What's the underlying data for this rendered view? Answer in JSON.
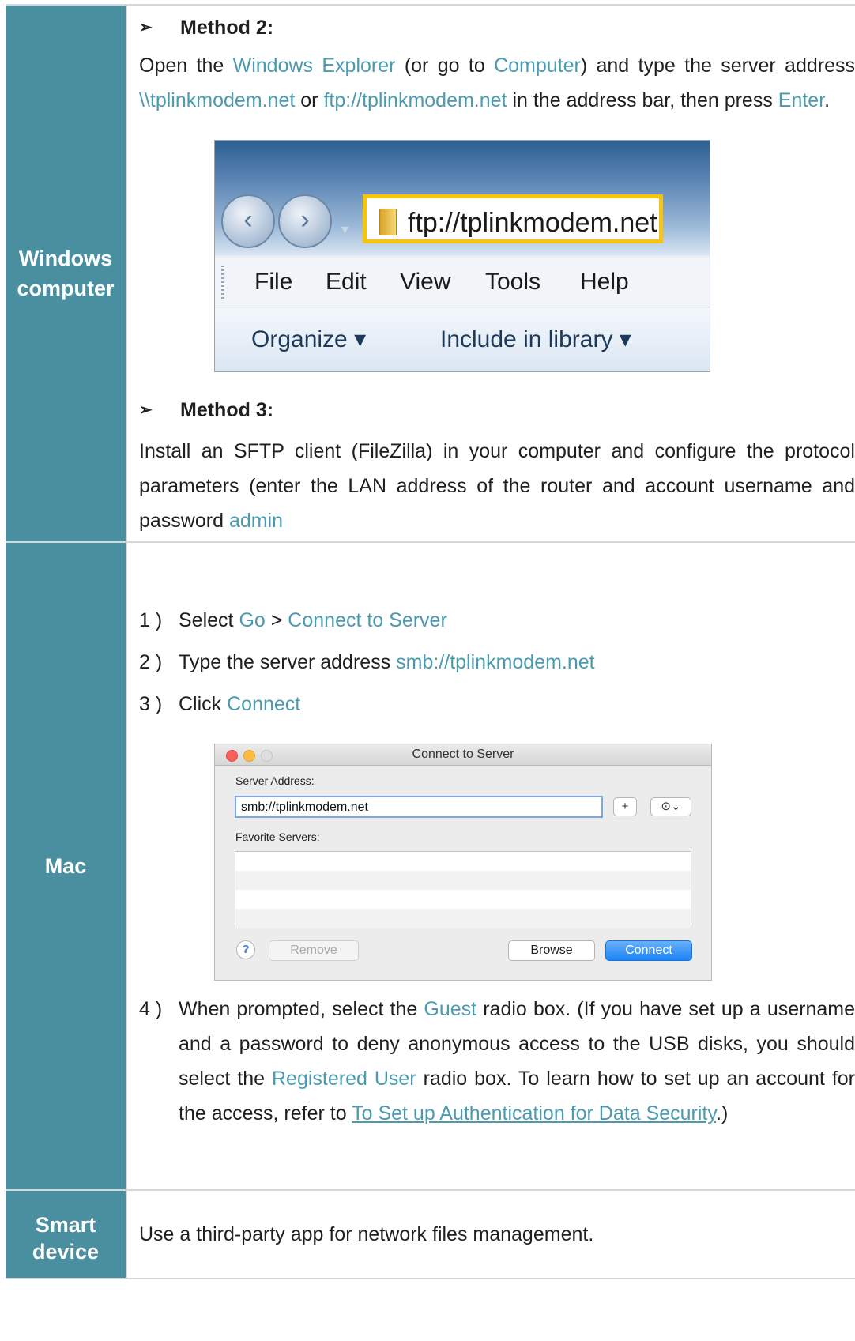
{
  "windows": {
    "label": "Windows computer",
    "method2": {
      "heading": "Method 2:",
      "t1": "Open the ",
      "h1": "Windows Explorer",
      "t2": " (or go to ",
      "h2": "Computer",
      "t3": ") and type the server address ",
      "h3": "\\\\tplinkmodem.net",
      "t4": " or ",
      "h4": "ftp://tplinkmodem.net",
      "t5": " in the address bar, then press ",
      "h5": "Enter",
      "t6": "."
    },
    "explorer": {
      "address": "ftp://tplinkmodem.net",
      "menu": [
        "File",
        "Edit",
        "View",
        "Tools",
        "Help"
      ],
      "organize": "Organize ▾",
      "include": "Include in library ▾"
    },
    "method3": {
      "heading": "Method 3:",
      "t1": "Install an SFTP client (FileZilla) in your computer and configure the protocol parameters (enter the LAN address of the router and account username and password ",
      "h1": "admin"
    }
  },
  "mac": {
    "label": "Mac",
    "steps": [
      {
        "num": "1 )",
        "t1": "Select ",
        "h1": "Go",
        "t2": " > ",
        "h2": "Connect to Server"
      },
      {
        "num": "2 )",
        "t1": "Type the server address ",
        "h1": "smb://tplinkmodem.net"
      },
      {
        "num": "3 )",
        "t1": "Click ",
        "h1": "Connect"
      }
    ],
    "dialog": {
      "title": "Connect to Server",
      "server_label": "Server Address:",
      "server_value": "smb://tplinkmodem.net",
      "add_label": "+",
      "recent_label": "⊙⌄",
      "favorites_label": "Favorite Servers:",
      "help_label": "?",
      "remove_label": "Remove",
      "browse_label": "Browse",
      "connect_label": "Connect"
    },
    "step4": {
      "num": "4 )",
      "t1": "When prompted, select the ",
      "h1": "Guest",
      "t2": " radio box. (If you have set up a username and a password to deny anonymous access to the USB disks, you should select the ",
      "h2": "Registered User",
      "t3": " radio box. To learn how to set up an account for the access, refer to ",
      "link": "To Set up Authentication for Data Security",
      "t4": ".)"
    }
  },
  "smart": {
    "label_1": "Smart",
    "label_2": "device",
    "text": "Use a third-party app for network files management."
  },
  "colors": {
    "label_bg": "#4a8f9f",
    "highlight": "#4b9bb0",
    "border": "#d5d8da"
  }
}
